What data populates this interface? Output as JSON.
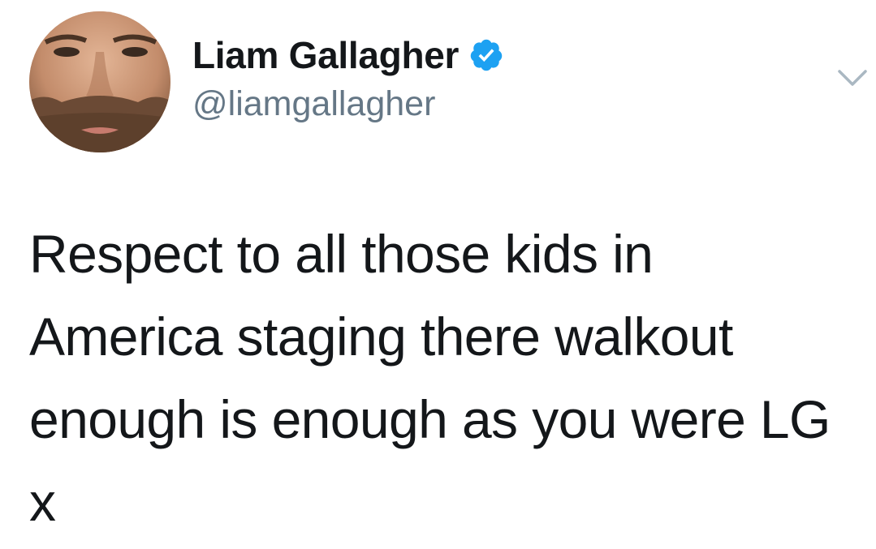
{
  "tweet": {
    "author": {
      "display_name": "Liam Gallagher",
      "handle": "@liamgallagher",
      "verified": true,
      "avatar_icon": "profile-photo"
    },
    "menu_icon": "chevron-down-icon",
    "text": "Respect to all those kids in\nAmerica staging there walkout\nenough is enough as you were LG\nx"
  },
  "colors": {
    "name": "#14171a",
    "handle": "#657786",
    "verified_badge": "#1da1f2",
    "chevron": "#aab8c2"
  }
}
